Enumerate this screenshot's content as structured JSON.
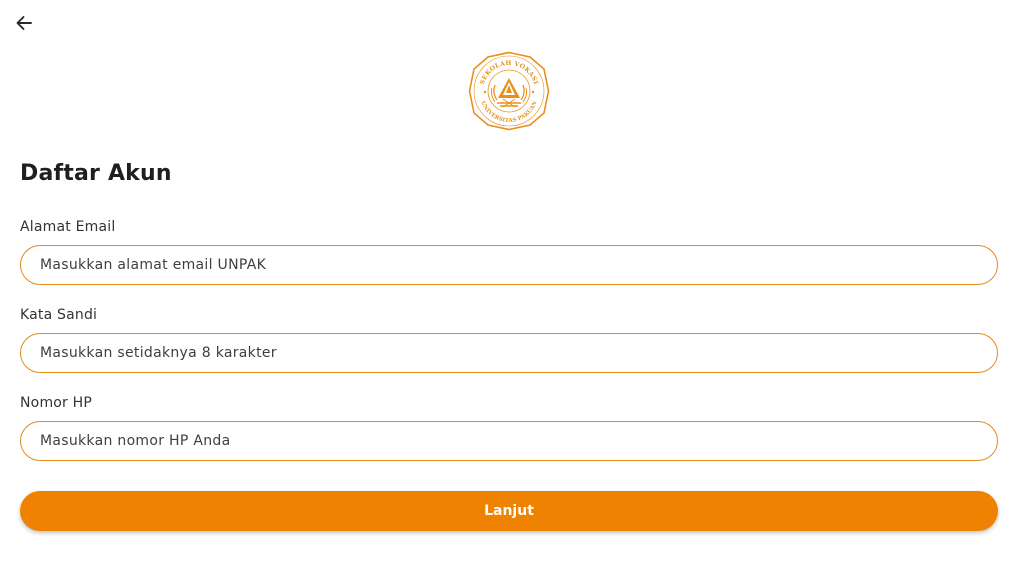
{
  "header": {
    "back_icon": "arrow-left-icon"
  },
  "logo": {
    "ring_text_top": "SEKOLAH VOKASI",
    "ring_text_bottom": "UNIVERSITAS PAKUAN",
    "color": "#E8901C"
  },
  "page": {
    "title": "Daftar Akun"
  },
  "form": {
    "email": {
      "label": "Alamat Email",
      "placeholder": "Masukkan alamat email UNPAK",
      "value": ""
    },
    "password": {
      "label": "Kata Sandi",
      "placeholder": "Masukkan setidaknya 8 karakter",
      "value": ""
    },
    "phone": {
      "label": "Nomor HP",
      "placeholder": "Masukkan nomor HP Anda",
      "value": ""
    },
    "submit_label": "Lanjut"
  },
  "colors": {
    "accent": "#EF8200",
    "input_border": "#E08A1A"
  }
}
